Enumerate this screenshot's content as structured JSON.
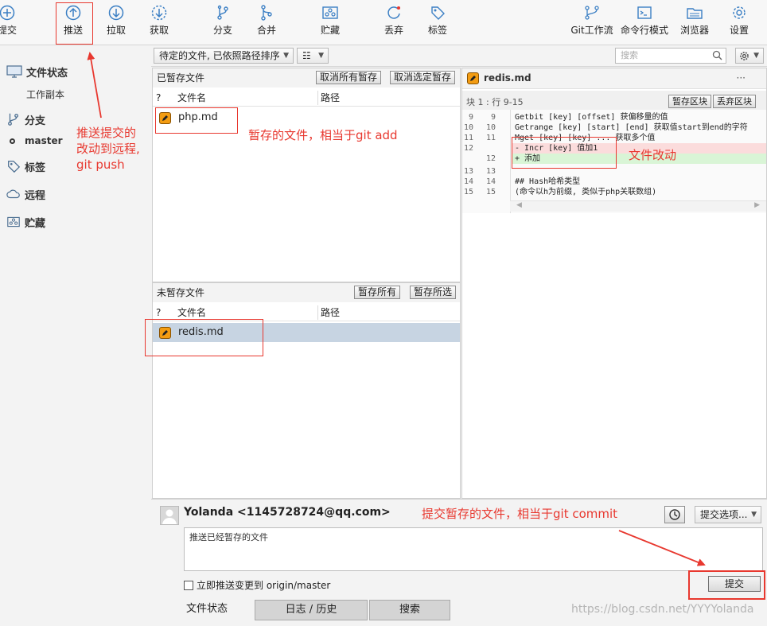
{
  "toolbar": {
    "commit": "提交",
    "push": "推送",
    "pull": "拉取",
    "fetch": "获取",
    "branch": "分支",
    "merge": "合并",
    "stash": "贮藏",
    "discard": "丢弃",
    "tag": "标签",
    "git_flow": "Git工作流",
    "terminal": "命令行模式",
    "browser": "浏览器",
    "settings": "设置"
  },
  "sidebar": {
    "file_status": "文件状态",
    "working_copy": "工作副本",
    "branches": "分支",
    "master": "master",
    "tags": "标签",
    "remotes": "远程",
    "stashes": "贮藏"
  },
  "filter": {
    "sort_option": "待定的文件, 已依照路径排序",
    "view_option": "☷",
    "search_placeholder": "搜索"
  },
  "staged": {
    "title": "已暂存文件",
    "unstage_all": "取消所有暂存",
    "unstage_selected": "取消选定暂存",
    "col_status": "?",
    "col_name": "文件名",
    "col_path": "路径",
    "files": [
      {
        "name": "php.md"
      }
    ]
  },
  "unstaged": {
    "title": "未暂存文件",
    "stage_all": "暂存所有",
    "stage_selected": "暂存所选",
    "col_status": "?",
    "col_name": "文件名",
    "col_path": "路径",
    "files": [
      {
        "name": "redis.md"
      }
    ]
  },
  "diff": {
    "file_name": "redis.md",
    "more": "···",
    "hunk_label": "块 1 : 行 9-15",
    "stage_hunk": "暂存区块",
    "discard_hunk": "丢弃区块",
    "lines": [
      {
        "old": "9",
        "new": "9",
        "text": "  Getbit [key] [offset] 获偏移量的值",
        "type": "ctx"
      },
      {
        "old": "10",
        "new": "10",
        "text": "  Getrange [key] [start] [end] 获取值start到end的字符",
        "type": "ctx"
      },
      {
        "old": "11",
        "new": "11",
        "text": "  Mget [key] [key] ... 获取多个值",
        "type": "ctx"
      },
      {
        "old": "12",
        "new": "",
        "text": "- Incr [key] 值加1",
        "type": "del"
      },
      {
        "old": "",
        "new": "12",
        "text": "+ 添加",
        "type": "add"
      },
      {
        "old": "13",
        "new": "13",
        "text": "",
        "type": "ctx"
      },
      {
        "old": "14",
        "new": "14",
        "text": "  ## Hash哈希类型",
        "type": "ctx"
      },
      {
        "old": "15",
        "new": "15",
        "text": "  (命令以h为前缀, 类似于php关联数组)",
        "type": "ctx"
      }
    ]
  },
  "commit": {
    "author": "Yolanda <1145728724@qq.com>",
    "message": "推送已经暂存的文件",
    "options_label": "提交选项...",
    "push_checkbox_label": "立即推送变更到 origin/master",
    "commit_button": "提交"
  },
  "tabs": {
    "file_status": "文件状态",
    "log_history": "日志 / 历史",
    "search": "搜索"
  },
  "annotations": {
    "push_note_1": "推送提交的",
    "push_note_2": "改动到远程,",
    "push_note_3": "git push",
    "staged_note": "暂存的文件，相当于git add",
    "diff_note": "文件改动",
    "commit_note": "提交暂存的文件，相当于git commit"
  },
  "watermark": "https://blog.csdn.net/YYYYolanda",
  "colors": {
    "accent_red": "#e8382f",
    "icon_blue": "#3b7fc4",
    "file_orange": "#f39c12",
    "selected_row": "#c7d4e2"
  }
}
